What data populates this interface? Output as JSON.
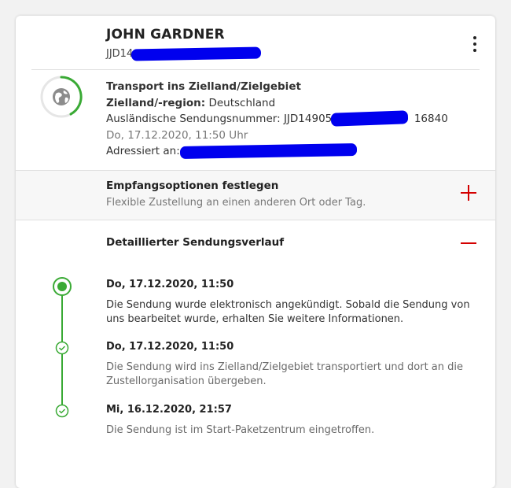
{
  "header": {
    "recipient_name": "JOHN GARDNER",
    "tracking_number": "JJD14",
    "menu_icon": "more-vertical-icon"
  },
  "status": {
    "icon": "globe-icon",
    "progress_color": "#3aaa35",
    "title": "Transport ins Zielland/Zielgebiet",
    "destination_label": "Zielland/-region:",
    "destination_value": "Deutschland",
    "foreign_number_label": "Ausländische Sendungsnummer:",
    "foreign_number_value": "JJD149055",
    "foreign_number_suffix": "16840",
    "datetime": "Do, 17.12.2020, 11:50 Uhr",
    "addressed_to_label": "Adressiert an:"
  },
  "delivery_options": {
    "title": "Empfangsoptionen festlegen",
    "subtitle": "Flexible Zustellung an einen anderen Ort oder Tag.",
    "expand_icon": "plus-icon"
  },
  "history": {
    "title": "Detaillierter Sendungsverlauf",
    "collapse_icon": "minus-icon",
    "events": [
      {
        "timestamp": "Do, 17.12.2020, 11:50",
        "description": "Die Sendung wurde elektronisch angekündigt. Sobald die Sendung von uns bearbeitet wurde, erhalten Sie weitere Informationen."
      },
      {
        "timestamp": "Do, 17.12.2020, 11:50",
        "description": "Die Sendung wird ins Zielland/Zielgebiet transportiert und dort an die Zustellorganisation übergeben."
      },
      {
        "timestamp": "Mi, 16.12.2020, 21:57",
        "description": "Die Sendung ist im Start-Paketzentrum eingetroffen."
      }
    ]
  },
  "colors": {
    "accent_red": "#d40000",
    "timeline_green": "#3aaa35",
    "redaction_blue": "#0000ee"
  }
}
